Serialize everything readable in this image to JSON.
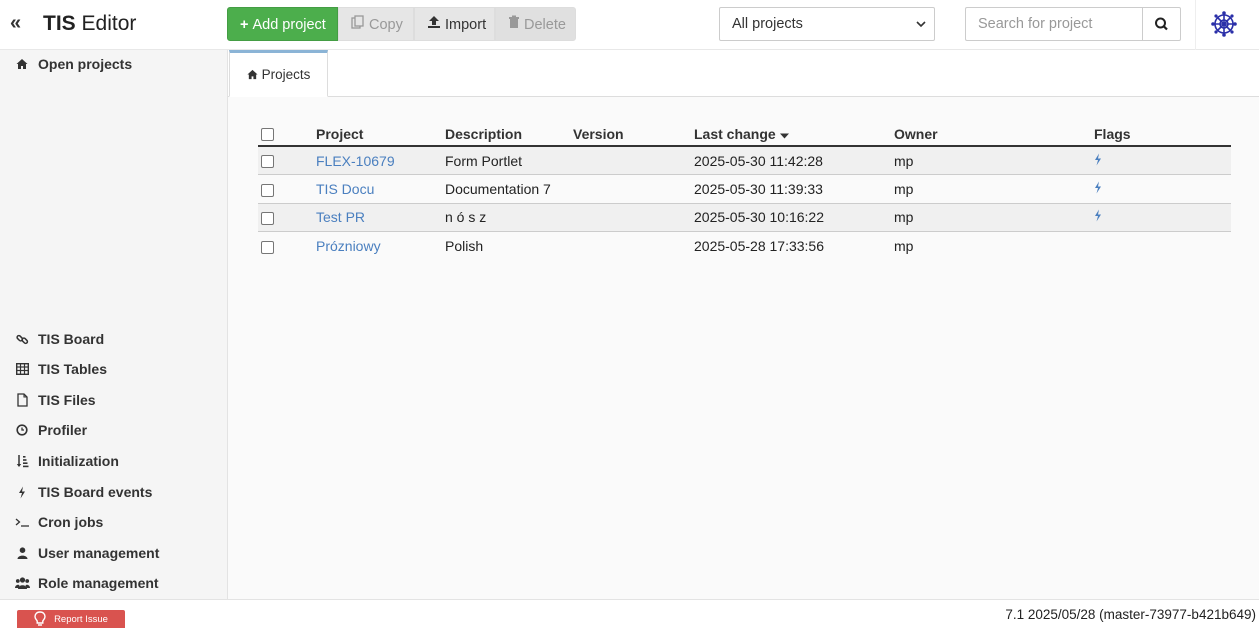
{
  "header": {
    "collapse_glyph": "«",
    "brand_bold": "TIS",
    "brand_rest": " Editor",
    "buttons": {
      "add": "Add project",
      "copy": "Copy",
      "import": "Import",
      "delete": "Delete"
    },
    "filter_value": "All projects",
    "search_placeholder": "Search for project"
  },
  "sidebar": {
    "top_item": {
      "label": "Open projects",
      "icon": "home-icon"
    },
    "items": [
      {
        "label": "TIS Board",
        "icon": "link-icon"
      },
      {
        "label": "TIS Tables",
        "icon": "table-icon"
      },
      {
        "label": "TIS Files",
        "icon": "file-icon"
      },
      {
        "label": "Profiler",
        "icon": "clock-icon"
      },
      {
        "label": "Initialization",
        "icon": "sort-icon"
      },
      {
        "label": "TIS Board events",
        "icon": "bolt-icon"
      },
      {
        "label": "Cron jobs",
        "icon": "terminal-icon"
      },
      {
        "label": "User management",
        "icon": "user-icon"
      },
      {
        "label": "Role management",
        "icon": "users-icon"
      }
    ]
  },
  "tabs": [
    {
      "label": "Projects",
      "icon": "home-icon"
    }
  ],
  "table": {
    "columns": [
      "Project",
      "Description",
      "Version",
      "Last change",
      "Owner",
      "Flags"
    ],
    "sort_column": "Last change",
    "rows": [
      {
        "project": "FLEX-10679",
        "description": "Form Portlet",
        "version": "",
        "last_change": "2025-05-30 11:42:28",
        "owner": "mp",
        "flag": true
      },
      {
        "project": "TIS Docu",
        "description": "Documentation 7",
        "version": "",
        "last_change": "2025-05-30 11:39:33",
        "owner": "mp",
        "flag": true
      },
      {
        "project": "Test PR",
        "description": "n ó s z",
        "version": "",
        "last_change": "2025-05-30 10:16:22",
        "owner": "mp",
        "flag": true
      },
      {
        "project": "Prózniowy",
        "description": "Polish",
        "version": "",
        "last_change": "2025-05-28 17:33:56",
        "owner": "mp",
        "flag": false
      }
    ]
  },
  "footer": {
    "report_label": "Report Issue",
    "version": "7.1 2025/05/28 (master-73977-b421b649)"
  },
  "colors": {
    "primary_green": "#4cae4c",
    "link_blue": "#4a7fbf",
    "report_red": "#d9534f",
    "tab_accent": "#8bb4d6"
  }
}
